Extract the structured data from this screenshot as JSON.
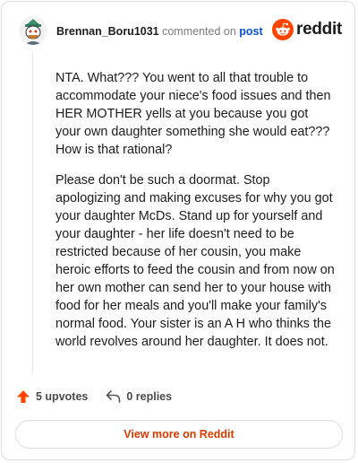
{
  "header": {
    "author": "Brennan_Boru1031",
    "action_text": "commented on",
    "post_link": "post",
    "brand": "reddit"
  },
  "comment": {
    "paragraphs": [
      "NTA. What??? You went to all that trouble to accommodate your niece's food issues and then HER MOTHER yells at you because you got your own daughter something she would eat??? How is that rational?",
      "Please don't be such a doormat. Stop apologizing and making excuses for why you got your daughter McDs. Stand up for yourself and your daughter - her life doesn't need to be restricted because of her cousin, you make heroic efforts to feed the cousin and from now on her own mother can send her to your house with food for her meals and you'll make your family's normal food. Your sister is an A H who thinks the world revolves around her daughter. It does not."
    ]
  },
  "actions": {
    "upvotes": "5 upvotes",
    "replies": "0 replies"
  },
  "footer": {
    "view_more": "View more on Reddit"
  },
  "colors": {
    "accent": "#ff4500",
    "link": "#0b4fd8",
    "button_text": "#d93a00"
  },
  "icons": {
    "avatar": "snoo-avatar",
    "brand": "reddit-logo-icon",
    "upvote": "upvote-arrow-icon",
    "reply": "reply-arrow-icon"
  }
}
